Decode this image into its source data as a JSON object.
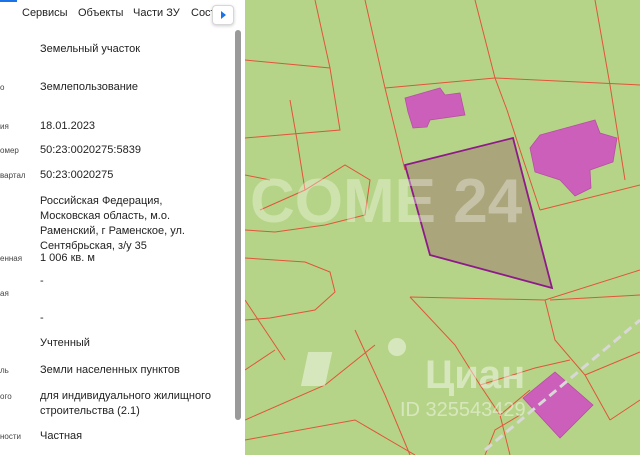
{
  "tabs": [
    {
      "label": "Сервисы"
    },
    {
      "label": "Объекты"
    },
    {
      "label": "Части ЗУ"
    },
    {
      "label": "Состав"
    }
  ],
  "tabs_next_icon": "chevron-right-icon",
  "properties": [
    {
      "label": "",
      "value": "Земельный участок"
    },
    {
      "label": "о",
      "value": "Землепользование"
    },
    {
      "label": "ия",
      "value": "18.01.2023"
    },
    {
      "label": "омер",
      "value": "50:23:0020275:5839"
    },
    {
      "label": "вартал",
      "value": "50:23:0020275"
    },
    {
      "label": "",
      "value": "Российская Федерация, Московская область, м.о. Раменский, г Раменское, ул. Сентябрьская, з/у 35"
    },
    {
      "label": "енная",
      "value": "1 006 кв. м"
    },
    {
      "label": "ая",
      "value": "-"
    },
    {
      "label": "",
      "value": "-"
    },
    {
      "label": "",
      "value": "Учтенный"
    },
    {
      "label": "ль",
      "value": "Земли населенных пунктов"
    },
    {
      "label": "ого",
      "value": "для индивидуального жилищного строительства (2.1)"
    },
    {
      "label": "ности",
      "value": "Частная"
    }
  ],
  "watermarks": {
    "logo1": "COME 24",
    "logo2": "Циан",
    "phone": "ID 325543429"
  },
  "colors": {
    "map_background": "#b6d487",
    "parcel_border": "#e0553a",
    "building_fill": "#cc5fba",
    "selected_parcel_fill": "#a99c7a",
    "selected_parcel_border": "#8e1a8a",
    "accent": "#1a73e8"
  }
}
